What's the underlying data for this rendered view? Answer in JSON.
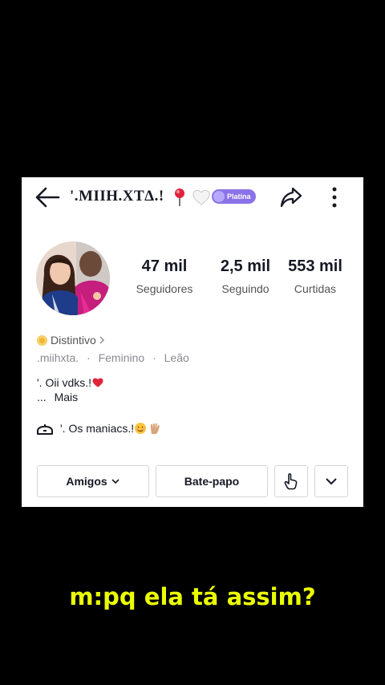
{
  "profile": {
    "title": "'.MIIH.XTΔ.!",
    "badge": "Platina",
    "handle": ".miihxta.",
    "gender": "Feminino",
    "sign": "Leão",
    "distintivo": "Distintivo",
    "bio_line1": "'. Oii vdks.!",
    "bio_line2_prefix": "...",
    "bio_more": "Mais",
    "group_name": "'. Os maniacs.!"
  },
  "stats": [
    {
      "value": "47 mil",
      "label": "Seguidores"
    },
    {
      "value": "2,5 mil",
      "label": "Seguindo"
    },
    {
      "value": "553 mil",
      "label": "Curtidas"
    }
  ],
  "actions": {
    "friends": "Amigos",
    "chat": "Bate-papo"
  },
  "icons": {
    "back": "arrow-left-icon",
    "share": "share-arrow-icon",
    "more": "more-vertical-icon",
    "pin": "pin-emoji-icon",
    "heart": "white-heart-emoji-icon",
    "group": "group-icon",
    "wave": "hand-pointer-icon",
    "expand": "chevron-down-icon"
  },
  "colors": {
    "caption": "#eaff00",
    "badge": "#8a72e8",
    "background": "#000000"
  },
  "caption": "m:pq ela tá assim?"
}
